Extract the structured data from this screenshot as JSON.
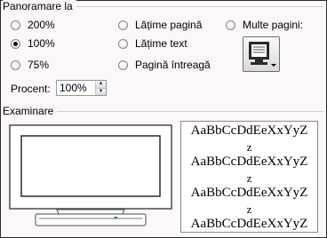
{
  "zoom_group": {
    "label": "Panoramare la",
    "options": [
      {
        "id": "200",
        "label": "200%",
        "checked": false
      },
      {
        "id": "100",
        "label": "100%",
        "checked": true
      },
      {
        "id": "75",
        "label": "75%",
        "checked": false
      },
      {
        "id": "page-width",
        "label": "Lățime pagină",
        "checked": false
      },
      {
        "id": "text-width",
        "label": "Lățime text",
        "checked": false
      },
      {
        "id": "whole-page",
        "label": "Pagină întreagă",
        "checked": false
      },
      {
        "id": "many-pages",
        "label": "Multe pagini:",
        "checked": false
      }
    ],
    "percent_label": "Procent:",
    "percent_value": "100%",
    "multi_pages_icon": "monitor-pages-dropdown-icon"
  },
  "preview_group": {
    "label": "Examinare",
    "monitor_icon": "monitor-preview-icon",
    "sample_lines": [
      "AaBbCcDdEeXxYyZ",
      "z",
      "AaBbCcDdEeXxYyZ",
      "z",
      "AaBbCcDdEeXxYyZ",
      "z",
      "AaBbCcDdEeXxYyZ"
    ]
  },
  "colors": {
    "background": "#fbf7fa",
    "monitor_led": "#14a05a"
  }
}
